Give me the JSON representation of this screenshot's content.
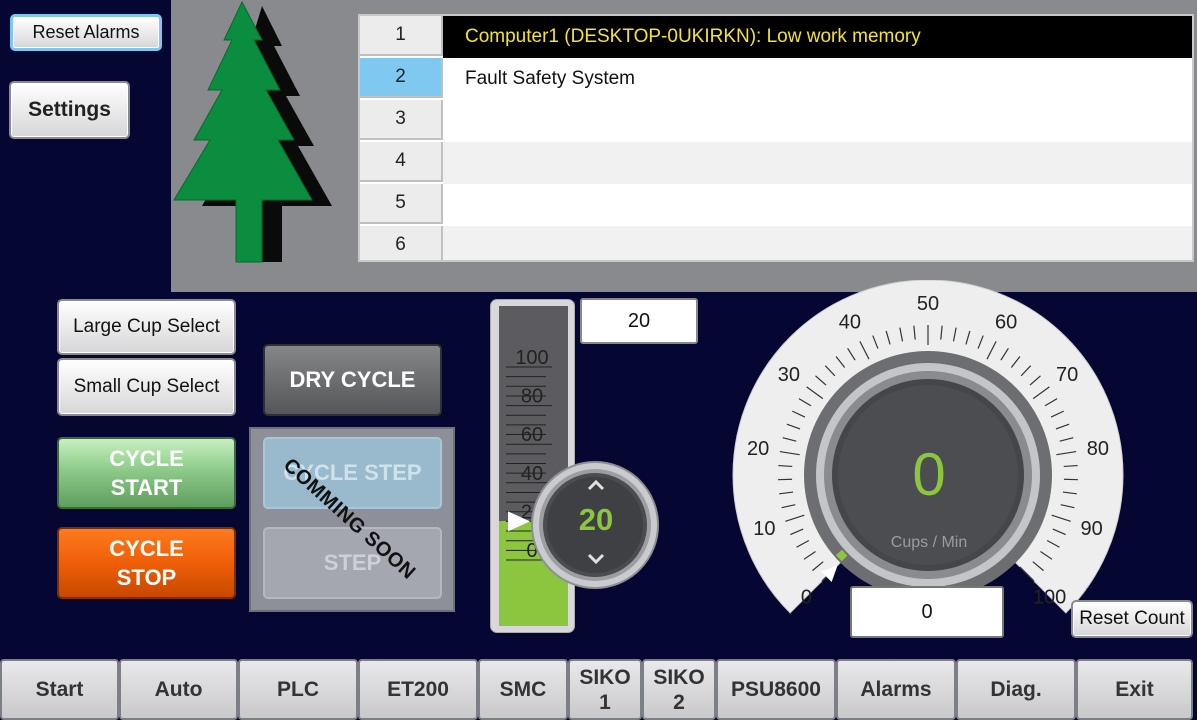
{
  "top_buttons": {
    "reset_alarms": "Reset Alarms",
    "settings": "Settings"
  },
  "alarms": {
    "rows": [
      {
        "num": "1",
        "message": "Computer1 (DESKTOP-0UKIRKN): Low work memory",
        "state": "selected"
      },
      {
        "num": "2",
        "message": "Fault Safety System",
        "state": "active"
      },
      {
        "num": "3",
        "message": "",
        "state": ""
      },
      {
        "num": "4",
        "message": "",
        "state": ""
      },
      {
        "num": "5",
        "message": "",
        "state": ""
      },
      {
        "num": "6",
        "message": "",
        "state": ""
      }
    ]
  },
  "controls": {
    "large_cup": "Large Cup Select",
    "small_cup": "Small Cup Select",
    "dry_cycle": "DRY CYCLE",
    "cycle_start": "CYCLE\nSTART",
    "cycle_stop": "CYCLE\nSTOP",
    "cycle_step": "CYCLE STEP",
    "step": "STEP",
    "coming_soon": "COMMING SOON"
  },
  "slider": {
    "setpoint_display": "20",
    "spinner_value": "20",
    "level": 20,
    "scale_min": 0,
    "scale_max": 100,
    "scale_labels": [
      "100",
      "80",
      "60",
      "40",
      "20",
      "0"
    ]
  },
  "gauge": {
    "value": "0",
    "unit": "Cups / Min",
    "min": 0,
    "max": 100,
    "labels": [
      "0",
      "10",
      "20",
      "30",
      "40",
      "50",
      "60",
      "70",
      "80",
      "90",
      "100"
    ],
    "count": "0",
    "reset_count": "Reset Count"
  },
  "nav": [
    {
      "label": "Start",
      "name": "nav-start"
    },
    {
      "label": "Auto",
      "name": "nav-auto"
    },
    {
      "label": "PLC",
      "name": "nav-plc"
    },
    {
      "label": "ET200",
      "name": "nav-et200"
    },
    {
      "label": "SMC",
      "name": "nav-smc"
    },
    {
      "label": "SIKO\n1",
      "name": "nav-siko-1"
    },
    {
      "label": "SIKO\n2",
      "name": "nav-siko-2"
    },
    {
      "label": "PSU8600",
      "name": "nav-psu8600"
    },
    {
      "label": "Alarms",
      "name": "nav-alarms"
    },
    {
      "label": "Diag.",
      "name": "nav-diag"
    },
    {
      "label": "Exit",
      "name": "nav-exit"
    }
  ],
  "colors": {
    "background": "#060633",
    "accent_green": "#8cc63f",
    "selected_row_bg": "#000000",
    "selected_row_text": "#f5e42a",
    "active_row_num": "#7fc9f0",
    "stop_orange": "#ee5f08"
  },
  "icons": {
    "tree": "pine-tree-icon",
    "spin_up": "chevron-up-icon",
    "spin_down": "chevron-down-icon"
  }
}
